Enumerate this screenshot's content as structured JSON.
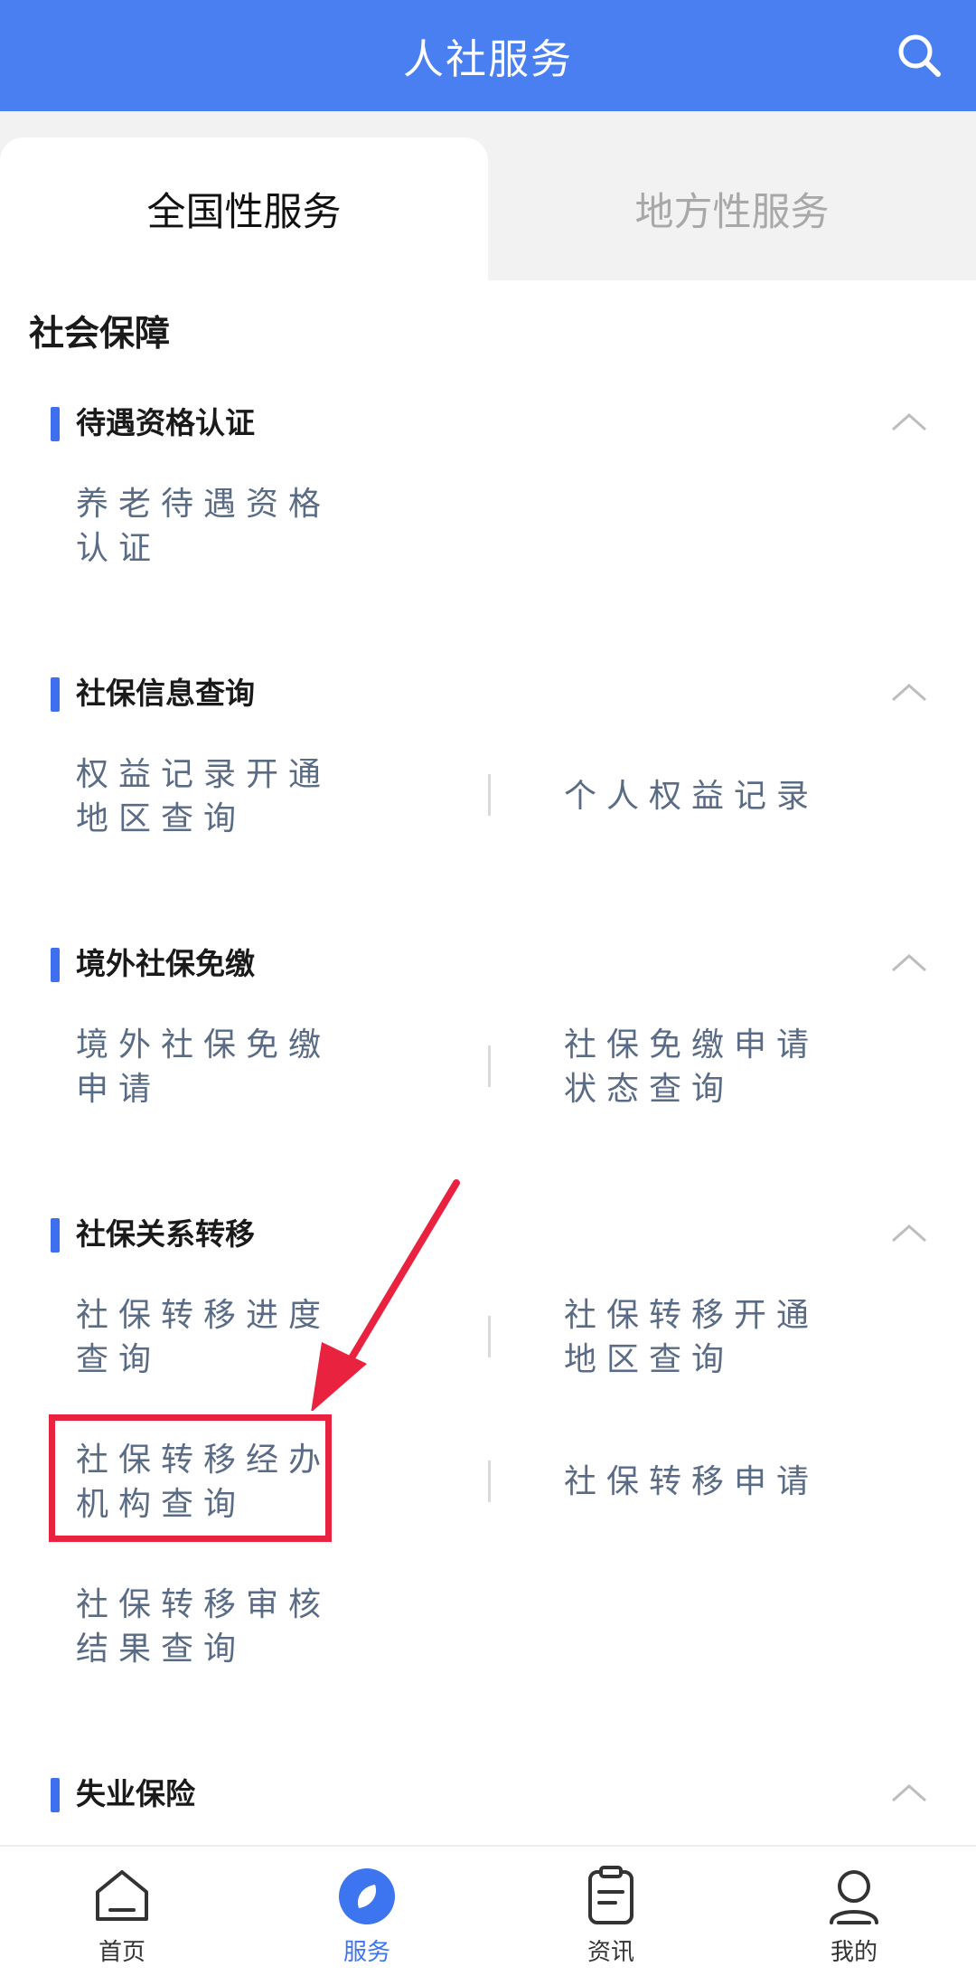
{
  "header": {
    "title": "人社服务",
    "search_icon": "search-icon"
  },
  "tabs": [
    {
      "label": "全国性服务",
      "active": true
    },
    {
      "label": "地方性服务",
      "active": false
    }
  ],
  "section_title": "社会保障",
  "categories": [
    {
      "title": "待遇资格认证",
      "items": [
        {
          "line1": "养老待遇资格",
          "line2": "认证"
        }
      ]
    },
    {
      "title": "社保信息查询",
      "items": [
        {
          "line1": "权益记录开通",
          "line2": "地区查询"
        },
        {
          "line1": "个人权益记录",
          "line2": ""
        }
      ]
    },
    {
      "title": "境外社保免缴",
      "items": [
        {
          "line1": "境外社保免缴",
          "line2": "申请"
        },
        {
          "line1": "社保免缴申请",
          "line2": "状态查询"
        }
      ]
    },
    {
      "title": "社保关系转移",
      "items": [
        {
          "line1": "社保转移进度",
          "line2": "查询"
        },
        {
          "line1": "社保转移开通",
          "line2": "地区查询"
        },
        {
          "line1": "社保转移经办",
          "line2": "机构查询"
        },
        {
          "line1": "社保转移申请",
          "line2": ""
        },
        {
          "line1": "社保转移审核",
          "line2": "结果查询"
        }
      ]
    },
    {
      "title": "失业保险",
      "items": []
    }
  ],
  "bottom_nav": [
    {
      "label": "首页",
      "icon": "home-icon",
      "active": false
    },
    {
      "label": "服务",
      "icon": "compass-icon",
      "active": true
    },
    {
      "label": "资讯",
      "icon": "clipboard-icon",
      "active": false
    },
    {
      "label": "我的",
      "icon": "user-icon",
      "active": false
    }
  ],
  "colors": {
    "header": "#4A7FF2",
    "accent": "#3D6FEF",
    "highlight": "#E8223F",
    "item_text": "#5A6B85"
  }
}
